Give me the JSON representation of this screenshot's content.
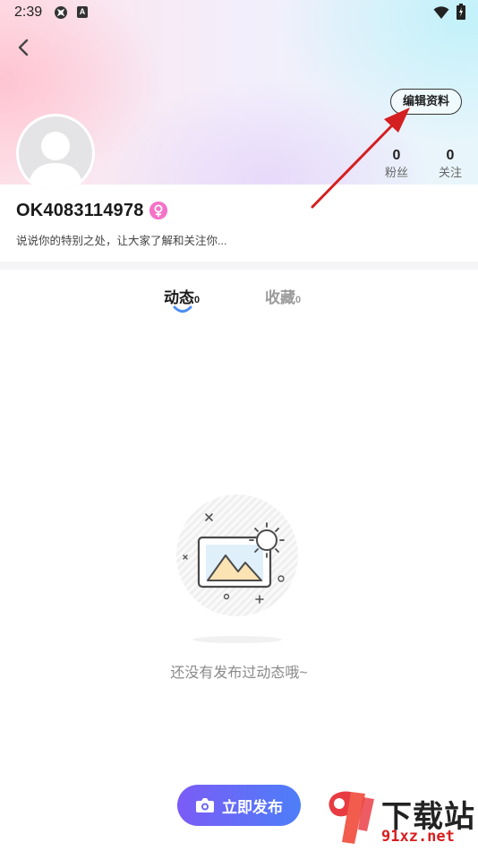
{
  "status_bar": {
    "time": "2:39",
    "notification_badge": "A"
  },
  "header": {
    "edit_profile_label": "编辑资料"
  },
  "stats": {
    "fans": {
      "value": "0",
      "label": "粉丝"
    },
    "following": {
      "value": "0",
      "label": "关注"
    }
  },
  "profile": {
    "username": "OK4083114978",
    "gender_icon": "female-icon",
    "bio": "说说你的特别之处，让大家了解和关注你..."
  },
  "tabs": [
    {
      "label": "动态",
      "count": "0",
      "active": true
    },
    {
      "label": "收藏",
      "count": "0",
      "active": false
    }
  ],
  "empty_state": {
    "message": "还没有发布过动态哦~"
  },
  "publish": {
    "label": "立即发布",
    "icon": "camera-icon"
  },
  "watermark": {
    "top_text": "下载站",
    "bottom_text": "91xz.net"
  },
  "colors": {
    "accent_gradient_start": "#7b5cf6",
    "accent_gradient_end": "#4d7ef8",
    "gender_badge": "#f472c8",
    "annotation_arrow": "#d42020"
  }
}
